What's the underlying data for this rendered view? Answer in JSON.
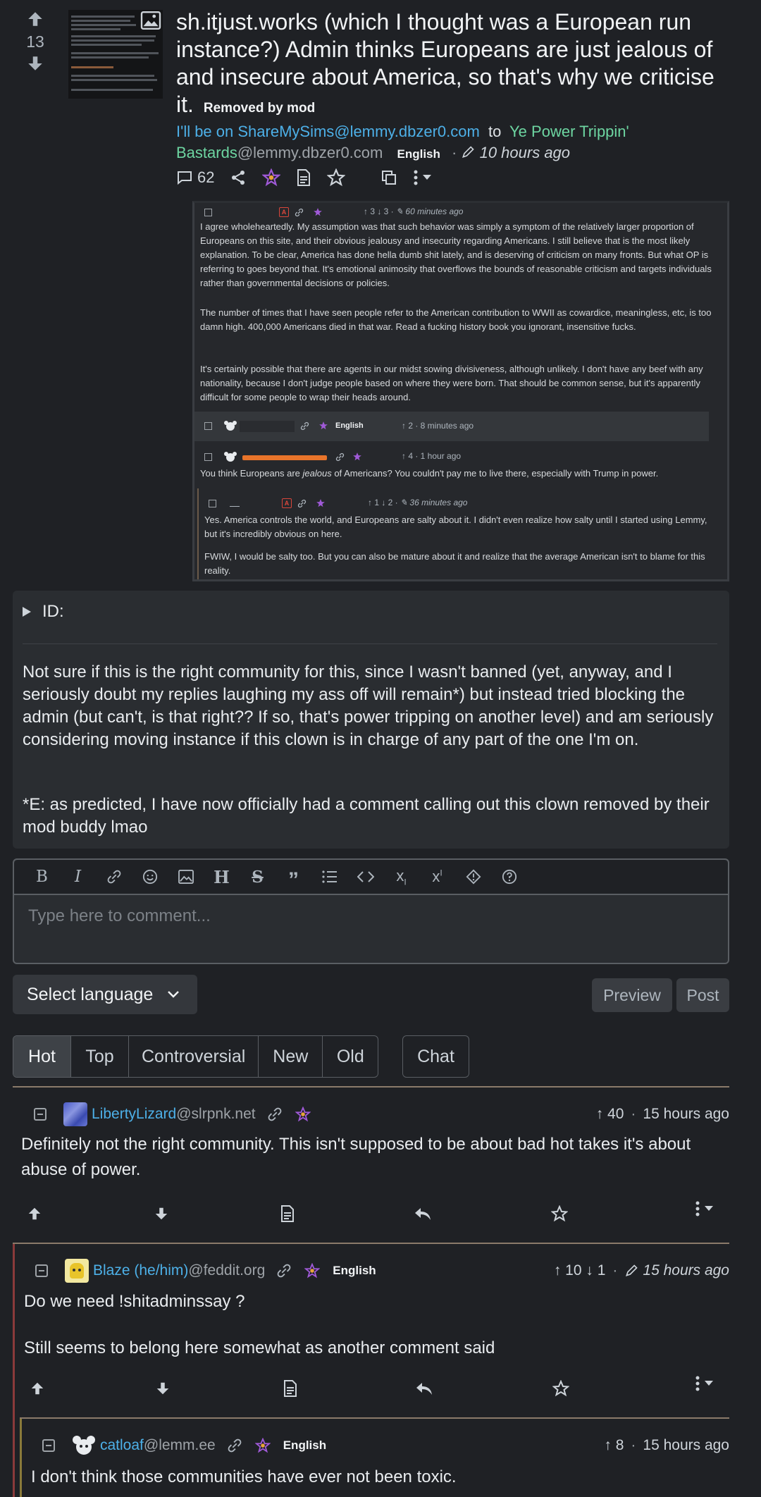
{
  "post": {
    "score": "13",
    "title": "sh.itjust.works (which I thought was a European run instance?) Admin thinks Europeans are just jealous of and insecure about America, so that's why we criticise it.",
    "removed": "Removed by mod",
    "author": "I'll be on ShareMySims@lemmy.dbzer0.com",
    "to": "to",
    "community": "Ye Power Trippin' Bastards",
    "community_instance": "@lemmy.dbzer0.com",
    "language": "English",
    "time": "10 hours ago",
    "comment_count": "62"
  },
  "screenshot": {
    "comment1_votes": "↑ 3 ↓ 3 · ",
    "comment1_time": "60 minutes ago",
    "comment1_p1": "I agree wholeheartedly. My assumption was that such behavior was simply a symptom of the relatively larger proportion of Europeans on this site, and their obvious jealousy and insecurity regarding Americans. I still believe that is the most likely explanation. To be clear, America has done hella dumb shit lately, and is deserving of criticism on many fronts. But what OP is referring to goes beyond that. It's emotional animosity that overflows the bounds of reasonable criticism and targets individuals rather than governmental decisions or policies.",
    "comment1_p2": "The number of times that I have seen people refer to the American contribution to WWII as cowardice, meaningless, etc, is too damn high. 400,000 Americans died in that war. Read a fucking history book you ignorant, insensitive fucks.",
    "comment1_p3": "It's certainly possible that there are agents in our midst sowing divisiveness, although unlikely. I don't have any beef with any nationality, because I don't judge people based on where they were born. That should be common sense, but it's apparently difficult for some people to wrap their heads around.",
    "comment2_lang": "English",
    "comment2_meta": "↑ 2 · 8 minutes ago",
    "comment3_meta": "↑ 4 · 1 hour ago",
    "comment3_pre": "You think Europeans are ",
    "comment3_em": "jealous",
    "comment3_post": " of Americans? You couldn't pay me to live there, especially with Trump in power.",
    "comment4_votes": "↑ 1 ↓ 2 · ",
    "comment4_time": "36 minutes ago",
    "comment4_p1": "Yes. America controls the world, and Europeans are salty about it. I didn't even realize how salty until I started using Lemmy, but it's incredibly obvious on here.",
    "comment4_p2": "FWIW, I would be salty too. But you can also be mature about it and realize that the average American isn't to blame for this reality."
  },
  "body": {
    "summary": "ID:",
    "p1": "Not sure if this is the right community for this, since I wasn't banned (yet, anyway, and I seriously doubt my replies laughing my ass off will remain*) but instead tried blocking the admin (but can't, is that right?? If so, that's power tripping on another level) and am seriously considering moving instance if this clown is in charge of any part of the one I'm on.",
    "p2": "*E: as predicted, I have now officially had a comment calling out this clown removed by their mod buddy lmao"
  },
  "editor": {
    "placeholder": "Type here to comment...",
    "select_language": "Select language",
    "preview": "Preview",
    "post": "Post"
  },
  "sort": {
    "tabs": [
      "Hot",
      "Top",
      "Controversial",
      "New",
      "Old"
    ],
    "chat": "Chat"
  },
  "comments": [
    {
      "user": "LibertyLizard",
      "instance": "@slrpnk.net",
      "votes": "↑ 40",
      "time": "15 hours ago",
      "body": "Definitely not the right community. This isn't supposed to be about bad hot takes it's about abuse of power."
    },
    {
      "user": "Blaze (he/him)",
      "instance": "@feddit.org",
      "language": "English",
      "votes": "↑ 10 ↓ 1",
      "time": "15 hours ago",
      "body1": "Do we need !shitadminssay ?",
      "body2": "Still seems to belong here somewhat as another comment said"
    },
    {
      "user": "catloaf",
      "instance": "@lemm.ee",
      "language": "English",
      "votes": "↑ 8",
      "time": "15 hours ago",
      "body": "I don't think those communities have ever not been toxic."
    }
  ],
  "colors": {
    "accent_blue": "#4db0e8",
    "community_green": "#6dd5a1",
    "background": "#1f2125"
  }
}
